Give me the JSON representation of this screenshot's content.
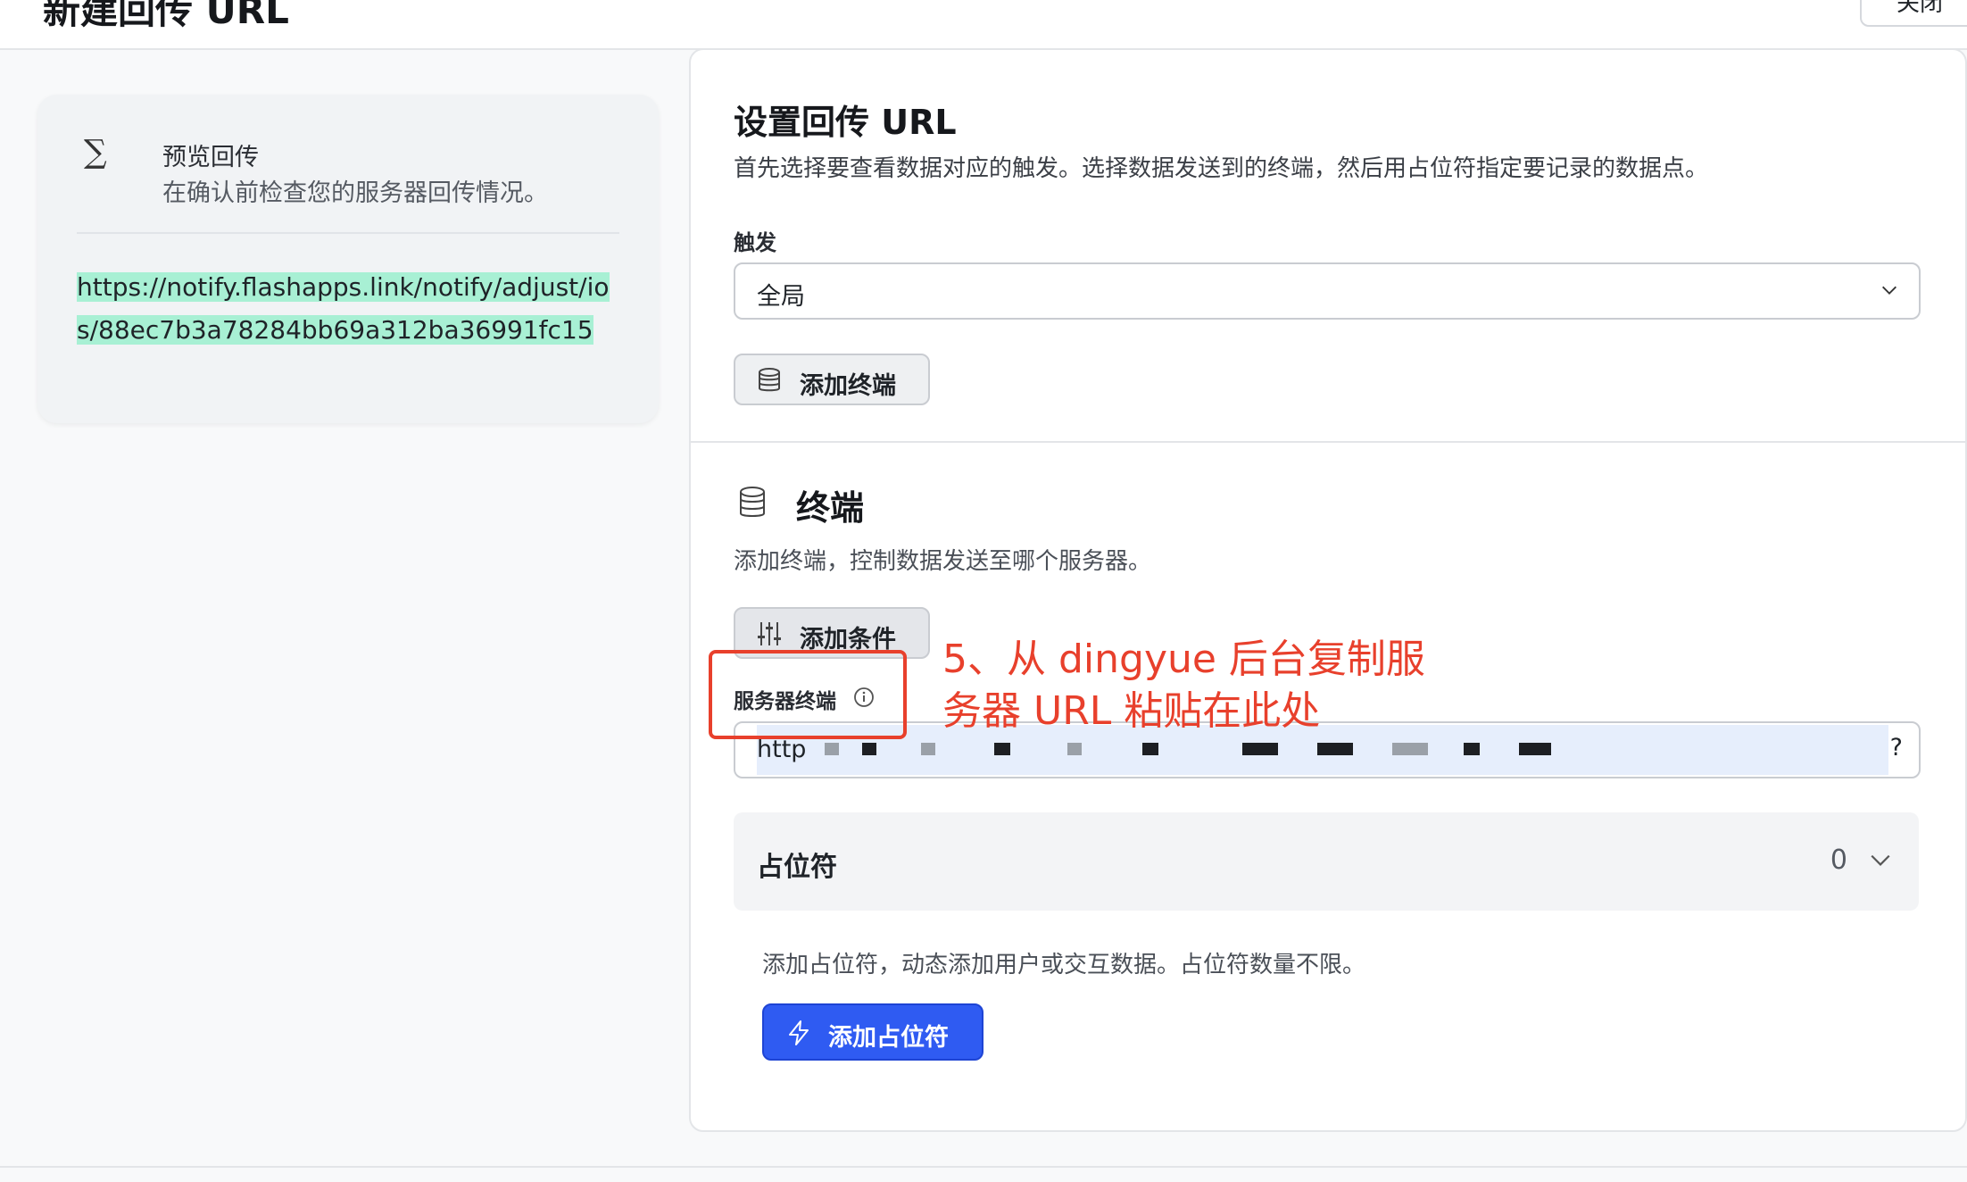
{
  "header": {
    "title": "新建回传 URL",
    "close_label": "关闭"
  },
  "preview": {
    "title": "预览回传",
    "subtitle": "在确认前检查您的服务器回传情况。",
    "url": "https://notify.flashapps.link/notify/adjust/ios/88ec7b3a78284bb69a312ba36991fc15",
    "icon": "sigma-icon"
  },
  "setup": {
    "title": "设置回传 URL",
    "description": "首先选择要查看数据对应的触发。选择数据发送到的终端，然后用占位符指定要记录的数据点。",
    "trigger_label": "触发",
    "trigger_value": "全局",
    "add_endpoint_label": "添加终端"
  },
  "endpoint": {
    "title": "终端",
    "description": "添加终端，控制数据发送至哪个服务器。",
    "add_condition_label": "添加条件",
    "server_label": "服务器终端",
    "server_value_prefix": "http",
    "server_value_suffix": "?"
  },
  "placeholders": {
    "title": "占位符",
    "count": "0",
    "description": "添加占位符，动态添加用户或交互数据。占位符数量不限。",
    "add_label": "添加占位符"
  },
  "annotation": {
    "text": "5、从 dingyue 后台复制服务器 URL 粘贴在此处",
    "color": "#e8402c"
  },
  "colors": {
    "primary": "#2f5bf2",
    "highlight": "#a8f0d4"
  }
}
